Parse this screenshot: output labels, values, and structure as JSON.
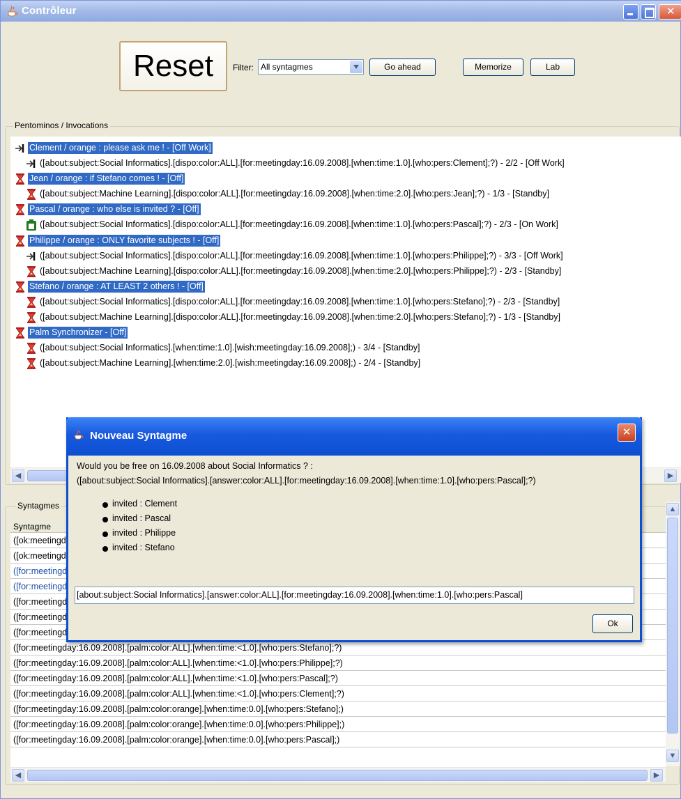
{
  "window": {
    "title": "Contrôleur"
  },
  "toolbar": {
    "reset_label": "Reset",
    "filter_label": "Filter:",
    "filter_value": "All syntagmes",
    "go_ahead_label": "Go ahead",
    "memorize_label": "Memorize",
    "lab_label": "Lab"
  },
  "tree_panel": {
    "title": "Pentominos / Invocations",
    "rows": [
      {
        "icon": "exit-arrow-icon",
        "text": "Clement / orange : please ask me ! - [Off Work]"
      },
      {
        "icon": "exit-arrow-icon",
        "text": "([about:subject:Social Informatics].[dispo:color:ALL].[for:meetingday:16.09.2008].[when:time:1.0].[who:pers:Clement];?) - 2/2 - [Off Work]"
      },
      {
        "icon": "hourglass-icon",
        "text": "Jean / orange : if Stefano comes ! - [Off]"
      },
      {
        "icon": "hourglass-icon",
        "text": "([about:subject:Machine Learning].[dispo:color:ALL].[for:meetingday:16.09.2008].[when:time:2.0].[who:pers:Jean];?) - 1/3 - [Standby]"
      },
      {
        "icon": "hourglass-icon",
        "text": "Pascal / orange : who else is invited ? - [Off]"
      },
      {
        "icon": "work-icon",
        "text": "([about:subject:Social Informatics].[dispo:color:ALL].[for:meetingday:16.09.2008].[when:time:1.0].[who:pers:Pascal];?) - 2/3 - [On Work]"
      },
      {
        "icon": "hourglass-icon",
        "text": "Philippe / orange : ONLY favorite subjects ! - [Off]"
      },
      {
        "icon": "exit-arrow-icon",
        "text": "([about:subject:Social Informatics].[dispo:color:ALL].[for:meetingday:16.09.2008].[when:time:1.0].[who:pers:Philippe];?) - 3/3 - [Off Work]"
      },
      {
        "icon": "hourglass-icon",
        "text": "([about:subject:Machine Learning].[dispo:color:ALL].[for:meetingday:16.09.2008].[when:time:2.0].[who:pers:Philippe];?) - 2/3 - [Standby]"
      },
      {
        "icon": "hourglass-icon",
        "text": "Stefano / orange : AT LEAST 2 others ! - [Off]"
      },
      {
        "icon": "hourglass-icon",
        "text": "([about:subject:Social Informatics].[dispo:color:ALL].[for:meetingday:16.09.2008].[when:time:1.0].[who:pers:Stefano];?) - 2/3 - [Standby]"
      },
      {
        "icon": "hourglass-icon",
        "text": "([about:subject:Machine Learning].[dispo:color:ALL].[for:meetingday:16.09.2008].[when:time:2.0].[who:pers:Stefano];?) - 1/3 - [Standby]"
      },
      {
        "icon": "hourglass-icon",
        "text": "Palm Synchronizer - [Off]"
      },
      {
        "icon": "hourglass-icon",
        "text": "([about:subject:Social Informatics].[when:time:1.0].[wish:meetingday:16.09.2008];) - 3/4 - [Standby]"
      },
      {
        "icon": "hourglass-icon",
        "text": "([about:subject:Machine Learning].[when:time:2.0].[wish:meetingday:16.09.2008];) - 2/4 - [Standby]"
      }
    ]
  },
  "syntagmes_panel": {
    "title": "Syntagmes",
    "column_header": "Syntagme",
    "rows": [
      "([ok:meetingday:16.09.2008].[palm:color:orange].[when:time:1.0];)",
      "([ok:meetingday:16.09.2008].[palm:color:orange].[when:time:2.0];)",
      "([for:meetingday:16.09.2008].[palm:color:ALL].[when:time:1.0].[who:pers:Pascal];?)",
      "([for:meetingday:16.09.2008].[palm:color:ALL].[when:time:1.0].[who:pers:Pascal];?)",
      "([for:meetingday:16.09.2008].[palm:color:ALL].[when:time:<2.0].[who:pers:Stefano];?)",
      "([for:meetingday:16.09.2008].[palm:color:ALL].[when:time:<2.0].[who:pers:Philippe];?)",
      "([for:meetingday:16.09.2008].[palm:color:ALL].[when:time:<2.0].[who:pers:Jean];?)",
      "([for:meetingday:16.09.2008].[palm:color:ALL].[when:time:<1.0].[who:pers:Stefano];?)",
      "([for:meetingday:16.09.2008].[palm:color:ALL].[when:time:<1.0].[who:pers:Philippe];?)",
      "([for:meetingday:16.09.2008].[palm:color:ALL].[when:time:<1.0].[who:pers:Pascal];?)",
      "([for:meetingday:16.09.2008].[palm:color:ALL].[when:time:<1.0].[who:pers:Clement];?)",
      "([for:meetingday:16.09.2008].[palm:color:orange].[when:time:0.0].[who:pers:Stefano];)",
      "([for:meetingday:16.09.2008].[palm:color:orange].[when:time:0.0].[who:pers:Philippe];)",
      "([for:meetingday:16.09.2008].[palm:color:orange].[when:time:0.0].[who:pers:Pascal];)"
    ]
  },
  "dialog": {
    "title": "Nouveau Syntagme",
    "message_line1": "Would you be free on 16.09.2008 about Social Informatics ? :",
    "message_line2": "([about:subject:Social Informatics].[answer:color:ALL].[for:meetingday:16.09.2008].[when:time:1.0].[who:pers:Pascal];?)",
    "invited": [
      "invited : Clement",
      "invited : Pascal",
      "invited : Philippe",
      "invited : Stefano"
    ],
    "input_value": "[about:subject:Social Informatics].[answer:color:ALL].[for:meetingday:16.09.2008].[when:time:1.0].[who:pers:Pascal]",
    "ok_label": "Ok"
  },
  "colors": {
    "selection": "#316ac5",
    "titlebar_inactive": "#a5bce9",
    "dialog_titlebar": "#0d4fd1",
    "blue_row_text": "#1e4fa6"
  }
}
